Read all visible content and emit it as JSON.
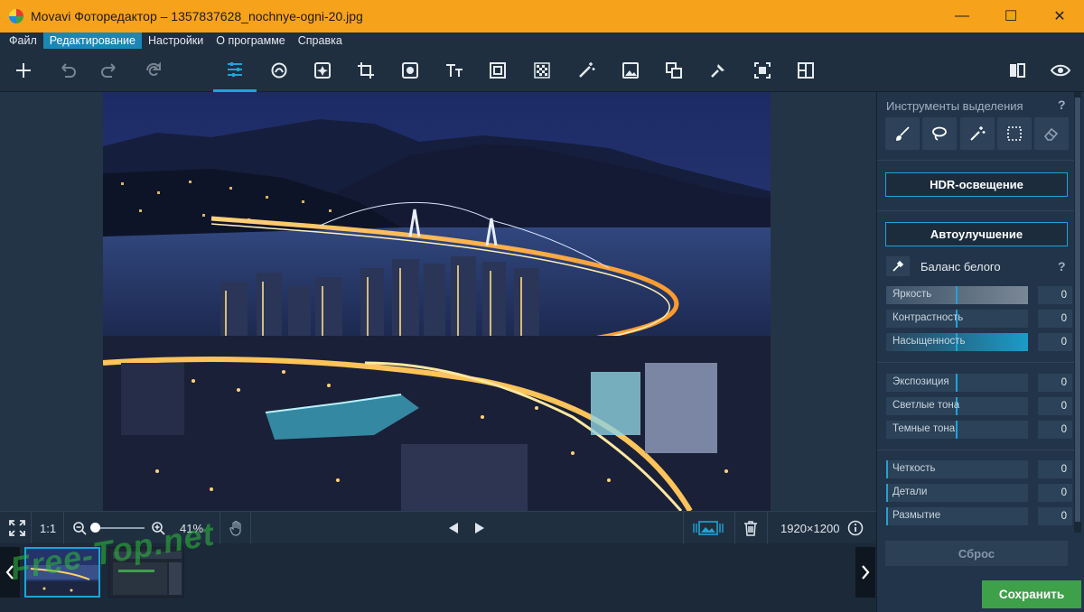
{
  "window": {
    "title": "Movavi Фоторедактор – 1357837628_nochnye-ogni-20.jpg",
    "minimize": "—",
    "maximize": "☐",
    "close": "✕"
  },
  "menu": [
    {
      "label": "Файл"
    },
    {
      "label": "Редактирование",
      "active": true
    },
    {
      "label": "Настройки"
    },
    {
      "label": "О программе"
    },
    {
      "label": "Справка"
    }
  ],
  "toolbar": {
    "tools": [
      "add-icon",
      "undo-icon",
      "redo-icon",
      "reset-icon",
      "adjust-icon",
      "retouch-icon",
      "enhance-icon",
      "crop-icon",
      "filters-icon",
      "text-icon",
      "frames-icon",
      "background-icon",
      "magic-icon",
      "image-icon",
      "objects-icon",
      "pin-icon",
      "selection-icon",
      "compare-icon"
    ],
    "right_tools": [
      "split-view-icon",
      "preview-eye-icon"
    ]
  },
  "bottom": {
    "zoom_one": "1:1",
    "zoom_percent": "41%",
    "zoom_level": 0.41,
    "resolution": "1920×1200"
  },
  "watermark": "Free-Top.net",
  "panel": {
    "selection_title": "Инструменты выделения",
    "help": "?",
    "selection_tools": [
      "brush-icon",
      "lasso-icon",
      "magic-wand-icon",
      "rect-select-icon",
      "eraser-icon"
    ],
    "hdr_label": "HDR-освещение",
    "auto_label": "Автоулучшение",
    "white_balance_label": "Баланс белого",
    "group1": [
      {
        "label": "Яркость",
        "value": "0"
      },
      {
        "label": "Контрастность",
        "value": "0"
      },
      {
        "label": "Насыщенность",
        "value": "0"
      }
    ],
    "group2": [
      {
        "label": "Экспозиция",
        "value": "0"
      },
      {
        "label": "Светлые тона",
        "value": "0"
      },
      {
        "label": "Темные тона",
        "value": "0"
      }
    ],
    "group3": [
      {
        "label": "Четкость",
        "value": "0"
      },
      {
        "label": "Детали",
        "value": "0"
      },
      {
        "label": "Размытие",
        "value": "0"
      }
    ],
    "reset_label": "Сброс",
    "save_label": "Сохранить"
  },
  "colors": {
    "accent": "#1fa3d8",
    "titlebar": "#f7a21b",
    "save": "#3ea049"
  }
}
